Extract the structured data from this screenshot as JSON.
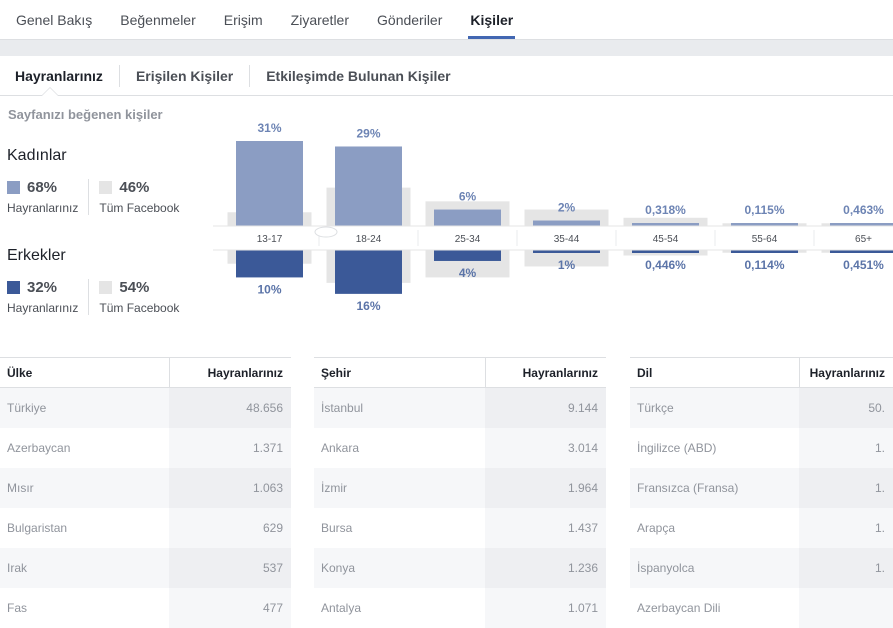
{
  "topnav": {
    "tabs": [
      "Genel Bakış",
      "Beğenmeler",
      "Erişim",
      "Ziyaretler",
      "Gönderiler",
      "Kişiler"
    ],
    "active": 5
  },
  "subnav": {
    "tabs": [
      "Hayranlarınız",
      "Erişilen Kişiler",
      "Etkileşimde Bulunan Kişiler"
    ],
    "active": 0
  },
  "demographics": {
    "title": "Sayfanızı beğenen kişiler",
    "women": {
      "title": "Kadınlar",
      "fans_pct": "68%",
      "fans_label": "Hayranlarınız",
      "fb_pct": "46%",
      "fb_label": "Tüm Facebook"
    },
    "men": {
      "title": "Erkekler",
      "fans_pct": "32%",
      "fans_label": "Hayranlarınız",
      "fb_pct": "54%",
      "fb_label": "Tüm Facebook"
    }
  },
  "colors": {
    "women": "#8b9dc3",
    "men": "#3b5998",
    "facebook": "#e5e5e5",
    "women_label": "#6d84b4",
    "men_label": "#5b74a8"
  },
  "chart_data": {
    "type": "bar",
    "categories": [
      "13-17",
      "18-24",
      "25-34",
      "35-44",
      "45-54",
      "55-64",
      "65+"
    ],
    "series": [
      {
        "name": "Kadınlar",
        "values": [
          31,
          29,
          6,
          2,
          0.318,
          0.115,
          0.463
        ],
        "labels": [
          "31%",
          "29%",
          "6%",
          "2%",
          "0,318%",
          "0,115%",
          "0,463%"
        ]
      },
      {
        "name": "Erkekler",
        "values": [
          10,
          16,
          4,
          1,
          0.446,
          0.114,
          0.451
        ],
        "labels": [
          "10%",
          "16%",
          "4%",
          "1%",
          "0,446%",
          "0,114%",
          "0,451%"
        ]
      }
    ],
    "facebook_women": [
      5,
      14,
      9,
      6,
      3,
      1,
      1
    ],
    "facebook_men": [
      5,
      12,
      10,
      6,
      2,
      1,
      1
    ]
  },
  "tables": [
    {
      "col1": "Ülke",
      "col2": "Hayranlarınız",
      "rows": [
        [
          "Türkiye",
          "48.656"
        ],
        [
          "Azerbaycan",
          "1.371"
        ],
        [
          "Mısır",
          "1.063"
        ],
        [
          "Bulgaristan",
          "629"
        ],
        [
          "Irak",
          "537"
        ],
        [
          "Fas",
          "477"
        ]
      ]
    },
    {
      "col1": "Şehir",
      "col2": "Hayranlarınız",
      "rows": [
        [
          "İstanbul",
          "9.144"
        ],
        [
          "Ankara",
          "3.014"
        ],
        [
          "İzmir",
          "1.964"
        ],
        [
          "Bursa",
          "1.437"
        ],
        [
          "Konya",
          "1.236"
        ],
        [
          "Antalya",
          "1.071"
        ]
      ]
    },
    {
      "col1": "Dil",
      "col2": "Hayranlarınız",
      "rows": [
        [
          "Türkçe",
          "50."
        ],
        [
          "İngilizce (ABD)",
          "1."
        ],
        [
          "Fransızca (Fransa)",
          "1."
        ],
        [
          "Arapça",
          "1."
        ],
        [
          "İspanyolca",
          "1."
        ],
        [
          "Azerbaycan Dili",
          ""
        ]
      ]
    }
  ]
}
